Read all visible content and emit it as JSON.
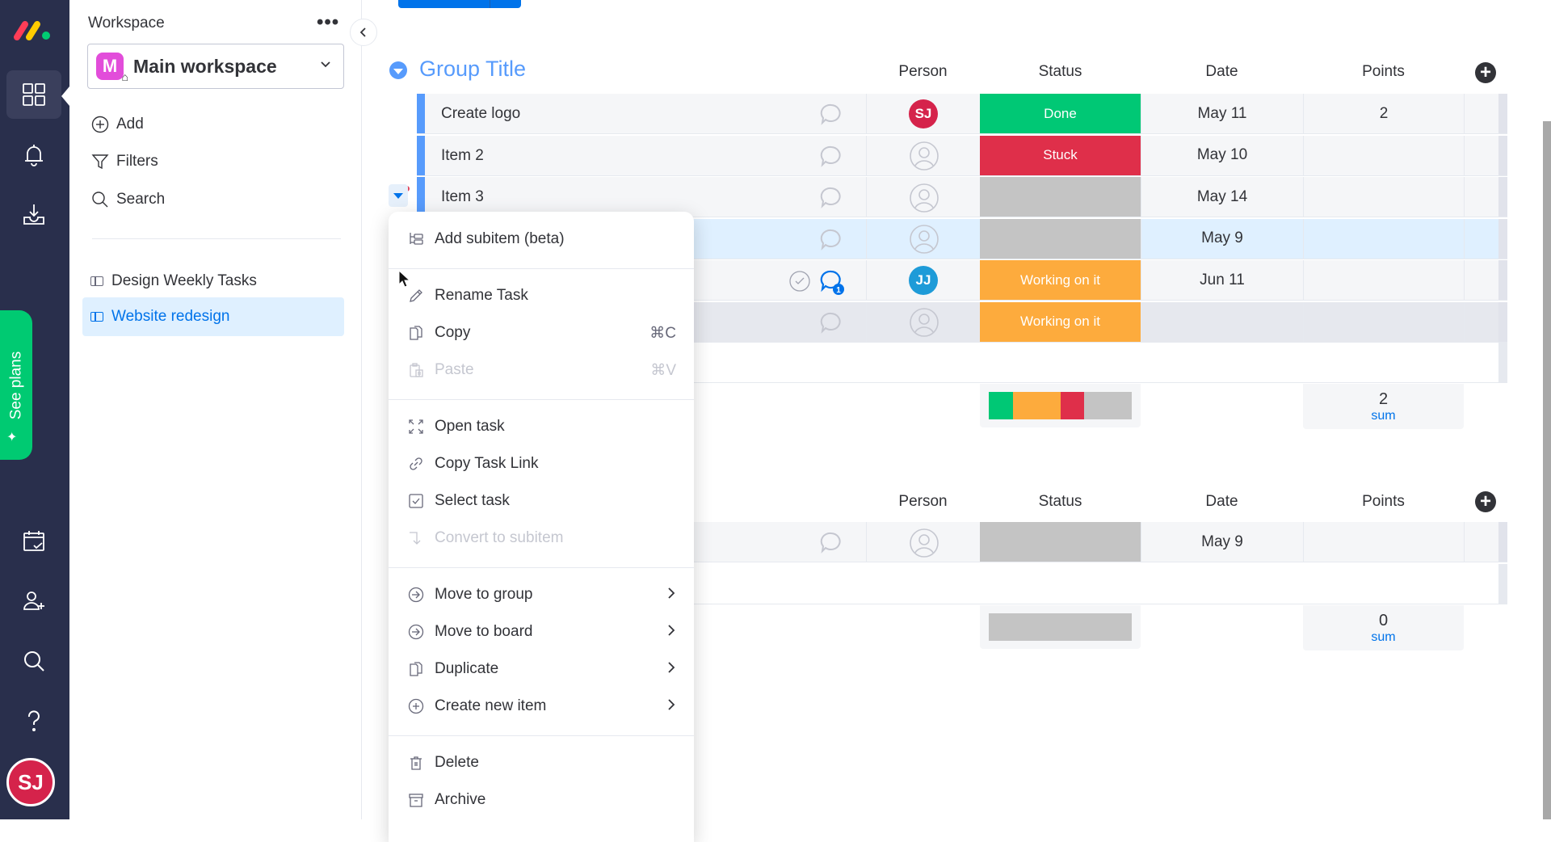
{
  "workspace": {
    "label": "Workspace",
    "more_icon": "more-horizontal-icon",
    "selected": "Main workspace",
    "badge_letter": "M",
    "actions": [
      {
        "label": "Add",
        "icon": "plus-circle-icon"
      },
      {
        "label": "Filters",
        "icon": "filter-icon"
      },
      {
        "label": "Search",
        "icon": "search-icon"
      }
    ],
    "boards": [
      {
        "label": "Design Weekly Tasks",
        "active": false
      },
      {
        "label": "Website redesign",
        "active": true
      }
    ]
  },
  "leftnav": {
    "items": [
      "workspaces-icon",
      "notifications-icon",
      "inbox-icon",
      "my-work-icon",
      "invite-members-icon",
      "search-icon",
      "help-icon"
    ],
    "see_plans": "See plans",
    "avatar_initials": "SJ"
  },
  "colors": {
    "done": "#00c875",
    "stuck": "#df2f4a",
    "working": "#fdab3d",
    "empty": "#c4c4c4",
    "group": "#579bfc",
    "accent": "#0073ea"
  },
  "groups": [
    {
      "title": "Group Title",
      "columns": [
        "Person",
        "Status",
        "Date",
        "Points"
      ],
      "rows": [
        {
          "name": "Create logo",
          "person": "SJ",
          "person_color": "#d5234b",
          "status": "Done",
          "status_key": "done",
          "date": "May 11",
          "points": "2"
        },
        {
          "name": "Item 2",
          "person": "",
          "status": "Stuck",
          "status_key": "stuck",
          "date": "May 10",
          "points": ""
        },
        {
          "name": "Item 3",
          "person": "",
          "status": "",
          "status_key": "empty",
          "date": "May 14",
          "points": ""
        },
        {
          "name": "",
          "person": "",
          "status": "",
          "status_key": "empty",
          "date": "May 9",
          "points": "",
          "highlight": true
        },
        {
          "name": "",
          "person": "JJ",
          "person_color": "#1e9bd8",
          "status": "Working on it",
          "status_key": "working",
          "date": "Jun 11",
          "points": "",
          "updates": "1"
        },
        {
          "name": "",
          "person": "",
          "status": "Working on it",
          "status_key": "working",
          "date": "",
          "points": "",
          "hover": true
        }
      ],
      "summary": {
        "status_distribution": [
          {
            "key": "done",
            "share": 1
          },
          {
            "key": "working",
            "share": 2
          },
          {
            "key": "stuck",
            "share": 1
          },
          {
            "key": "empty",
            "share": 2
          }
        ],
        "points_value": "2",
        "points_label": "sum"
      }
    },
    {
      "title": "",
      "columns": [
        "Person",
        "Status",
        "Date",
        "Points"
      ],
      "rows": [
        {
          "name": "",
          "person": "",
          "status": "",
          "status_key": "empty",
          "date": "May 9",
          "points": ""
        }
      ],
      "summary": {
        "status_distribution": [
          {
            "key": "empty",
            "share": 1
          }
        ],
        "points_value": "0",
        "points_label": "sum"
      }
    }
  ],
  "context_menu": {
    "items": [
      {
        "label": "Add subitem (beta)",
        "icon": "subitem-icon"
      },
      {
        "label": "Rename Task",
        "icon": "pencil-icon"
      },
      {
        "label": "Copy",
        "icon": "copy-icon",
        "shortcut": "⌘C"
      },
      {
        "label": "Paste",
        "icon": "paste-icon",
        "shortcut": "⌘V",
        "disabled": true
      },
      {
        "label": "Open task",
        "icon": "expand-icon"
      },
      {
        "label": "Copy Task Link",
        "icon": "link-icon"
      },
      {
        "label": "Select task",
        "icon": "checkbox-icon"
      },
      {
        "label": "Convert to subitem",
        "icon": "convert-arrow-icon",
        "disabled": true
      },
      {
        "label": "Move to group",
        "icon": "arrow-circle-icon",
        "submenu": true
      },
      {
        "label": "Move to board",
        "icon": "arrow-circle-icon",
        "submenu": true
      },
      {
        "label": "Duplicate",
        "icon": "duplicate-icon",
        "submenu": true
      },
      {
        "label": "Create new item",
        "icon": "plus-circle-icon",
        "submenu": true
      },
      {
        "label": "Delete",
        "icon": "trash-icon"
      },
      {
        "label": "Archive",
        "icon": "archive-icon"
      }
    ]
  }
}
